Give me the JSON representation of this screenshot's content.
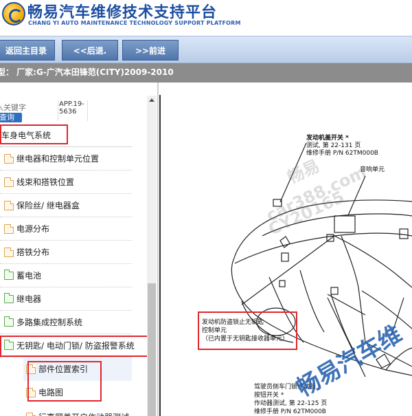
{
  "header": {
    "title_cn": "畅易汽车维修技术支持平台",
    "title_en": "CHANG YI AUTO MAINTENANCE TECHNOLOGY SUPPORT PLATFORM"
  },
  "nav": {
    "home": "返回主目录",
    "back": "<<后退.",
    "forward": ">>前进"
  },
  "model_bar": "型： 厂家:G-广汽本田锋范(CITY)2009-2010",
  "search": {
    "placeholder": "入关键字",
    "button": "查询",
    "code": "APP.19-5636"
  },
  "tree": {
    "section": "车身电气系统",
    "items": [
      {
        "label": "继电器和控制单元位置",
        "icon": "file-icon"
      },
      {
        "label": "线束和搭铁位置",
        "icon": "file-icon"
      },
      {
        "label": "保险丝/ 继电器盒",
        "icon": "file-icon"
      },
      {
        "label": "电源分布",
        "icon": "file-icon"
      },
      {
        "label": "搭铁分布",
        "icon": "file-icon"
      },
      {
        "label": "蓄电池",
        "icon": "folder-icon"
      },
      {
        "label": "继电器",
        "icon": "folder-icon"
      },
      {
        "label": "多路集成控制系统",
        "icon": "folder-icon"
      },
      {
        "label": "无钥匙/ 电动门锁/ 防盗报警系统",
        "icon": "folder-icon"
      },
      {
        "label": "部件位置索引",
        "icon": "file-icon"
      },
      {
        "label": "电路图",
        "icon": "file-icon"
      },
      {
        "label": "行李厢盖开启作动器测试",
        "icon": "file-icon"
      }
    ]
  },
  "diagram": {
    "callout1_line1": "发动机盖开关 *",
    "callout1_line2": "测试, 第 22-131 页",
    "callout1_line3": "维修手册 P/N 62TM000B",
    "callout2": "音响单元",
    "callout3_line1": "发动机防盗锁止无钥匙",
    "callout3_line2": "控制单元",
    "callout3_line3": "（已内置于无钥匙接收器单元）",
    "callout4_line1": "驾驶员侧车门锁作动器 /",
    "callout4_line2": "按钮开关 *",
    "callout4_line3": "作动器测试, 第 22-125 页",
    "callout4_line4": "维修手册 P/N 62TM000B",
    "watermark1": "畅易",
    "watermark2": "car388.com",
    "watermark3": "CY20165",
    "watermark4": "畅易汽车维"
  }
}
